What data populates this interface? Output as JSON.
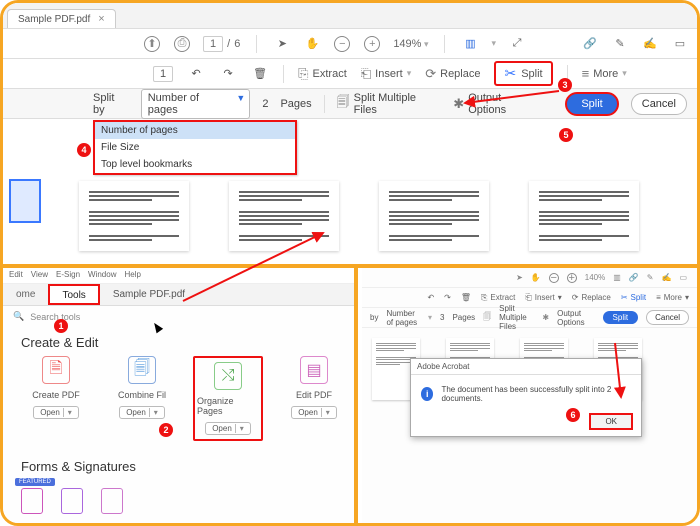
{
  "panelA": {
    "tab_filename": "Sample PDF.pdf",
    "viewer": {
      "page_current": "1",
      "page_sep": "/",
      "page_total": "6",
      "zoom_pct": "149%"
    },
    "toolbar": {
      "page_value": "1",
      "extract": "Extract",
      "insert": "Insert",
      "replace": "Replace",
      "split": "Split",
      "more": "More"
    },
    "splitbar": {
      "splitby": "Split by",
      "mode_value": "Number of pages",
      "count": "2",
      "pages": "Pages",
      "multi": "Split Multiple Files",
      "output": "Output Options",
      "split_btn": "Split",
      "cancel_btn": "Cancel"
    },
    "dropdown": {
      "opt1": "Number of pages",
      "opt2": "File Size",
      "opt3": "Top level bookmarks"
    }
  },
  "panelB": {
    "menus": {
      "m2": "Edit",
      "m3": "View",
      "m4": "E-Sign",
      "m5": "Window",
      "m6": "Help"
    },
    "tabs": {
      "home": "ome",
      "tools": "Tools",
      "file": "Sample PDF.pdf"
    },
    "search_placeholder": "Search tools",
    "heading_create": "Create & Edit",
    "tiles": {
      "t1": {
        "label": "Create PDF",
        "open": "Open"
      },
      "t2": {
        "label": "Combine Fil",
        "open": "Open"
      },
      "t3": {
        "label": "Organize Pages",
        "open": "Open"
      },
      "t4": {
        "label": "Edit PDF",
        "open": "Open"
      }
    },
    "heading_forms": "Forms & Signatures",
    "featured_badge": "FEATURED"
  },
  "panelC": {
    "toolbar": {
      "zoom": "140%",
      "extract": "Extract",
      "insert": "Insert",
      "replace": "Replace",
      "split": "Split",
      "more": "More"
    },
    "splitbar": {
      "by": "by",
      "mode": "Number of pages",
      "count": "3",
      "pages": "Pages",
      "multi": "Split Multiple Files",
      "output": "Output Options",
      "split_btn": "Split",
      "cancel_btn": "Cancel"
    },
    "dialog": {
      "title": "Adobe Acrobat",
      "body": "The document has been successfully split into 2 documents.",
      "ok": "OK"
    }
  },
  "callouts": {
    "c1": "1",
    "c2": "2",
    "c3": "3",
    "c4": "4",
    "c5": "5",
    "c6": "6"
  }
}
